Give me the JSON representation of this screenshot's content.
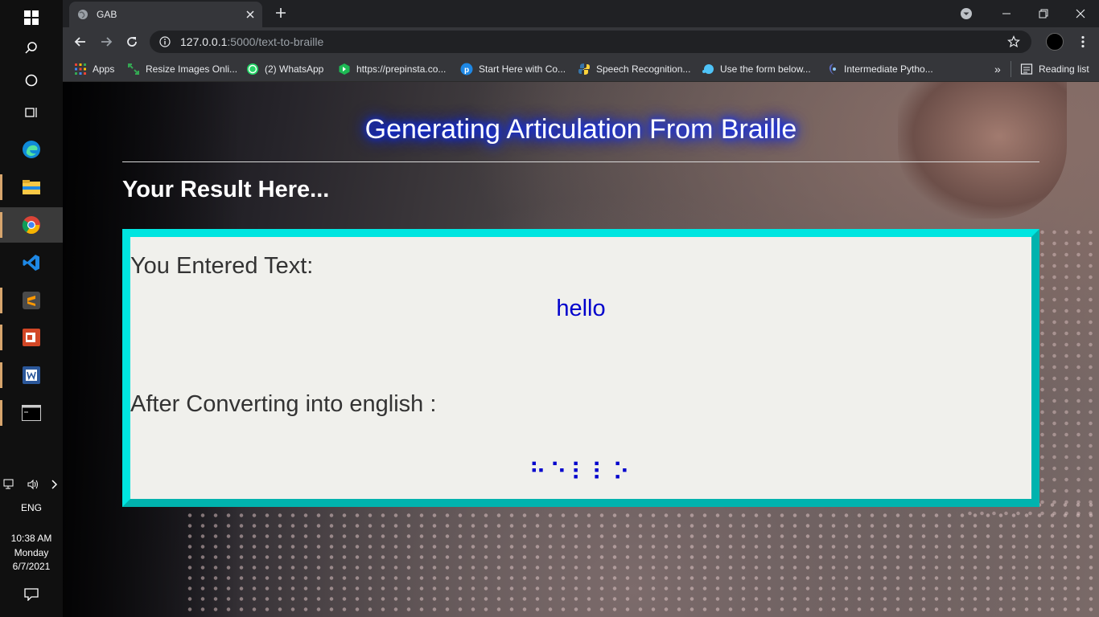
{
  "taskbar": {
    "lang": "ENG",
    "time": "10:38 AM",
    "day": "Monday",
    "date": "6/7/2021"
  },
  "browser": {
    "tab_title": "GAB",
    "url_host": "127.0.0.1",
    "url_path": ":5000/text-to-braille",
    "bookmarks": [
      {
        "label": "Apps",
        "color": "#ea4335"
      },
      {
        "label": "Resize Images Onli...",
        "color": "#34a853"
      },
      {
        "label": "(2) WhatsApp",
        "color": "#25d366"
      },
      {
        "label": "https://prepinsta.co...",
        "color": "#1db954"
      },
      {
        "label": "Start Here with Co...",
        "color": "#1e88e5"
      },
      {
        "label": "Speech Recognition...",
        "color": "#f4c542"
      },
      {
        "label": "Use the form below...",
        "color": "#4fc3f7"
      },
      {
        "label": "Intermediate Pytho...",
        "color": "#5c6bc0"
      }
    ],
    "reading_list": "Reading list",
    "more_bookmarks": "»"
  },
  "page": {
    "title": "Generating Articulation From Braille",
    "subheading": "Your Result Here...",
    "entered_label": "You Entered Text:",
    "entered_value": "hello",
    "converted_label": "After Converting into english :",
    "converted_value": "⠓⠑⠇⠇⠕"
  },
  "colors": {
    "box_border": "#00e5e0",
    "result_text": "#0000cc",
    "title_glow": "#0a2cff"
  }
}
